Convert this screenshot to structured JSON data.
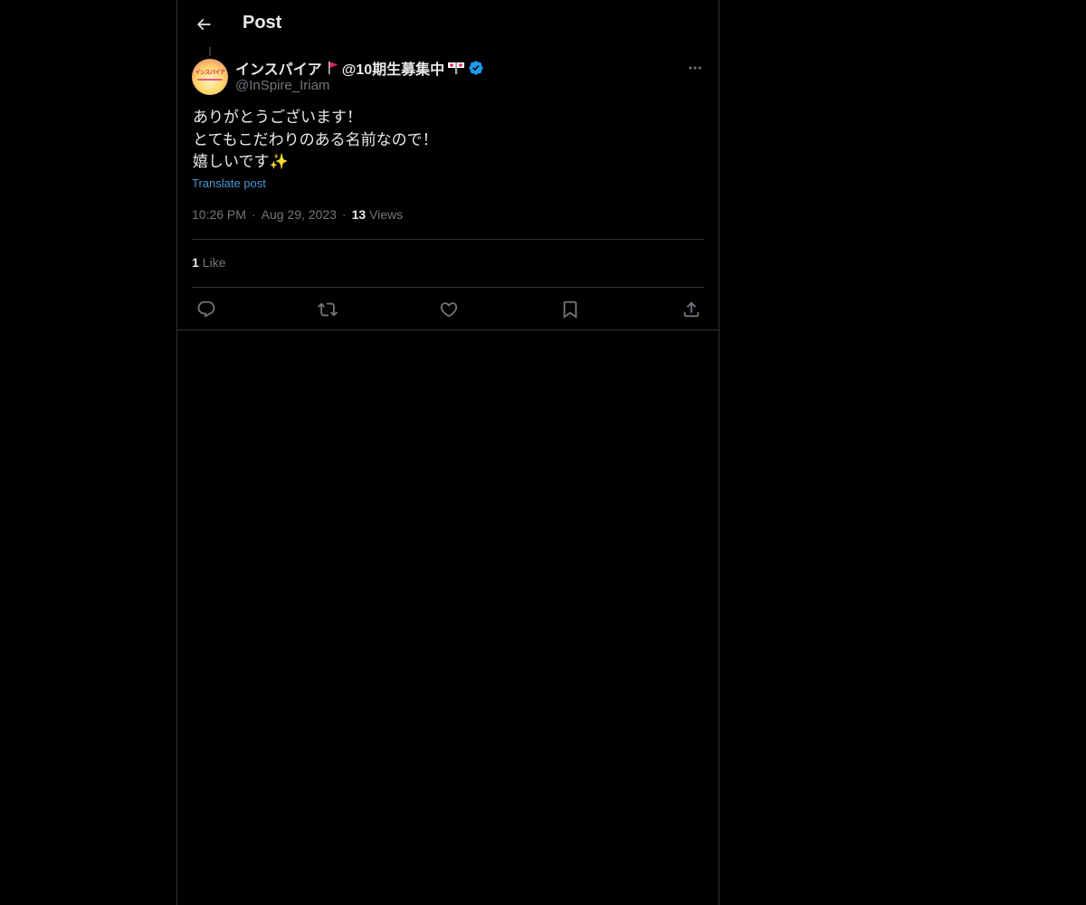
{
  "header": {
    "title": "Post"
  },
  "post": {
    "author": {
      "name": "インスパイア",
      "name_suffix": "@10期生募集中",
      "handle": "@InSpire_Iriam",
      "avatar_text": "インスパイア"
    },
    "lines": [
      "ありがとうございます！",
      "とてもこだわりのある名前なので！",
      "嬉しいです✨"
    ],
    "translate_label": "Translate post",
    "time": "10:26 PM",
    "date": "Aug 29, 2023",
    "views_count": "13",
    "views_label": "Views",
    "likes_count": "1",
    "likes_label": "Like"
  },
  "icons": {
    "back": "arrow-left-icon",
    "more": "ellipsis-icon",
    "reply": "reply-icon",
    "repost": "repost-icon",
    "like": "heart-icon",
    "bookmark": "bookmark-icon",
    "share": "share-icon",
    "verified": "verified-badge-icon"
  },
  "colors": {
    "background": "#000000",
    "text": "#e7e9ea",
    "secondary": "#71767b",
    "link": "#4a97d5",
    "verified": "#1d9bf0",
    "border": "#2f3336"
  }
}
